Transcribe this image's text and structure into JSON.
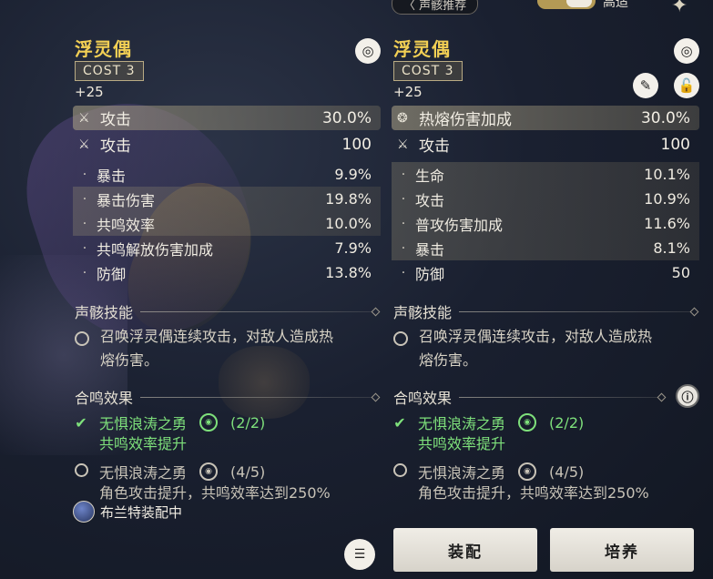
{
  "topbar": {
    "recommend_label": "〈 声骸推荐",
    "toggle_label": "高适",
    "star_icon": "star-icon"
  },
  "left": {
    "name": "浮灵偶",
    "cost": "COST  3",
    "level": "+25",
    "main_stats": [
      {
        "icon": "attack-icon",
        "name": "攻击",
        "value": "30.0%"
      },
      {
        "icon": "attack-icon",
        "name": "攻击",
        "value": "100"
      }
    ],
    "sub_stats": [
      {
        "name": "暴击",
        "value": "9.9%"
      },
      {
        "name": "暴击伤害",
        "value": "19.8%"
      },
      {
        "name": "共鸣效率",
        "value": "10.0%"
      },
      {
        "name": "共鸣解放伤害加成",
        "value": "7.9%"
      },
      {
        "name": "防御",
        "value": "13.8%"
      }
    ],
    "skill_title": "声骸技能",
    "skill_line1": "召唤浮灵偶连续攻击，对敌人造成热",
    "skill_line2": "熔伤害。",
    "sonata_title": "合鸣效果",
    "sonata_active": {
      "name": "无惧浪涛之勇",
      "count": "(2/2)",
      "desc": "共鸣效率提升"
    },
    "sonata_inactive": {
      "name": "无惧浪涛之勇",
      "count": "(4/5)",
      "desc": "角色攻击提升，共鸣效率达到250%"
    },
    "equipped_text": "布兰特装配中"
  },
  "right": {
    "name": "浮灵偶",
    "cost": "COST  3",
    "level": "+25",
    "main_stats": [
      {
        "icon": "fusion-damage-icon",
        "name": "热熔伤害加成",
        "value": "30.0%"
      },
      {
        "icon": "attack-icon",
        "name": "攻击",
        "value": "100"
      }
    ],
    "sub_stats": [
      {
        "name": "生命",
        "value": "10.1%"
      },
      {
        "name": "攻击",
        "value": "10.9%"
      },
      {
        "name": "普攻伤害加成",
        "value": "11.6%"
      },
      {
        "name": "暴击",
        "value": "8.1%"
      },
      {
        "name": "防御",
        "value": "50"
      }
    ],
    "skill_title": "声骸技能",
    "skill_line1": "召唤浮灵偶连续攻击，对敌人造成热",
    "skill_line2": "熔伤害。",
    "sonata_title": "合鸣效果",
    "sonata_active": {
      "name": "无惧浪涛之勇",
      "count": "(2/2)",
      "desc": "共鸣效率提升"
    },
    "sonata_inactive": {
      "name": "无惧浪涛之勇",
      "count": "(4/5)",
      "desc": "角色攻击提升，共鸣效率达到250%"
    }
  },
  "buttons": {
    "equip": "装配",
    "cultivate": "培养"
  }
}
